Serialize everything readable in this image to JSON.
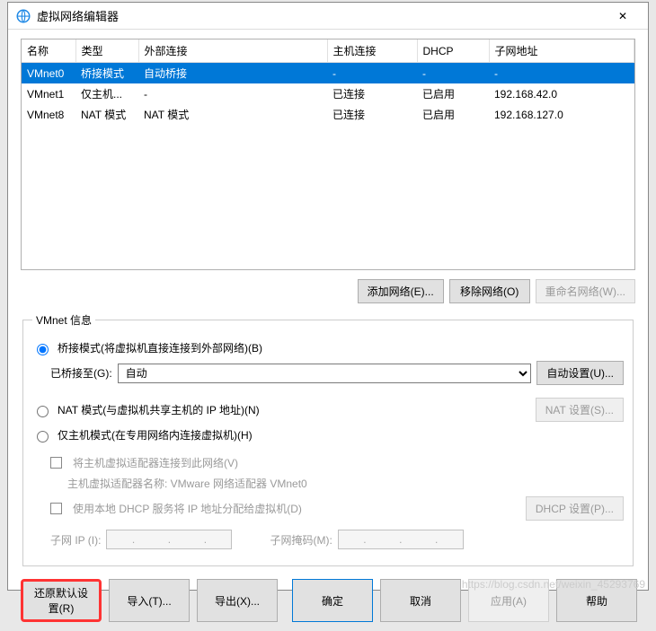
{
  "titlebar": {
    "title": "虚拟网络编辑器",
    "close_glyph": "✕"
  },
  "table": {
    "headers": {
      "name": "名称",
      "type": "类型",
      "ext": "外部连接",
      "host": "主机连接",
      "dhcp": "DHCP",
      "subnet": "子网地址"
    },
    "rows": [
      {
        "name": "VMnet0",
        "type": "桥接模式",
        "ext": "自动桥接",
        "host": "-",
        "dhcp": "-",
        "subnet": "-",
        "selected": true
      },
      {
        "name": "VMnet1",
        "type": "仅主机...",
        "ext": "-",
        "host": "已连接",
        "dhcp": "已启用",
        "subnet": "192.168.42.0",
        "selected": false
      },
      {
        "name": "VMnet8",
        "type": "NAT 模式",
        "ext": "NAT 模式",
        "host": "已连接",
        "dhcp": "已启用",
        "subnet": "192.168.127.0",
        "selected": false
      }
    ]
  },
  "net_buttons": {
    "add": "添加网络(E)...",
    "remove": "移除网络(O)",
    "rename": "重命名网络(W)..."
  },
  "vmnet_info": {
    "legend": "VMnet 信息",
    "bridge_label": "桥接模式(将虚拟机直接连接到外部网络)(B)",
    "bridged_to": "已桥接至(G):",
    "bridged_value": "自动",
    "auto_settings": "自动设置(U)...",
    "nat_label": "NAT 模式(与虚拟机共享主机的 IP 地址)(N)",
    "nat_settings": "NAT 设置(S)...",
    "hostonly_label": "仅主机模式(在专用网络内连接虚拟机)(H)",
    "connect_host": "将主机虚拟适配器连接到此网络(V)",
    "adapter_name": "主机虚拟适配器名称: VMware 网络适配器 VMnet0",
    "use_dhcp": "使用本地 DHCP 服务将 IP 地址分配给虚拟机(D)",
    "dhcp_settings": "DHCP 设置(P)...",
    "subnet_ip": "子网 IP (I):",
    "subnet_mask": "子网掩码(M):",
    "dot": "."
  },
  "bottom": {
    "restore": "还原默认设置(R)",
    "import": "导入(T)...",
    "export": "导出(X)...",
    "ok": "确定",
    "cancel": "取消",
    "apply": "应用(A)",
    "help": "帮助"
  },
  "watermark": "https://blog.csdn.net/weixin_45293769"
}
